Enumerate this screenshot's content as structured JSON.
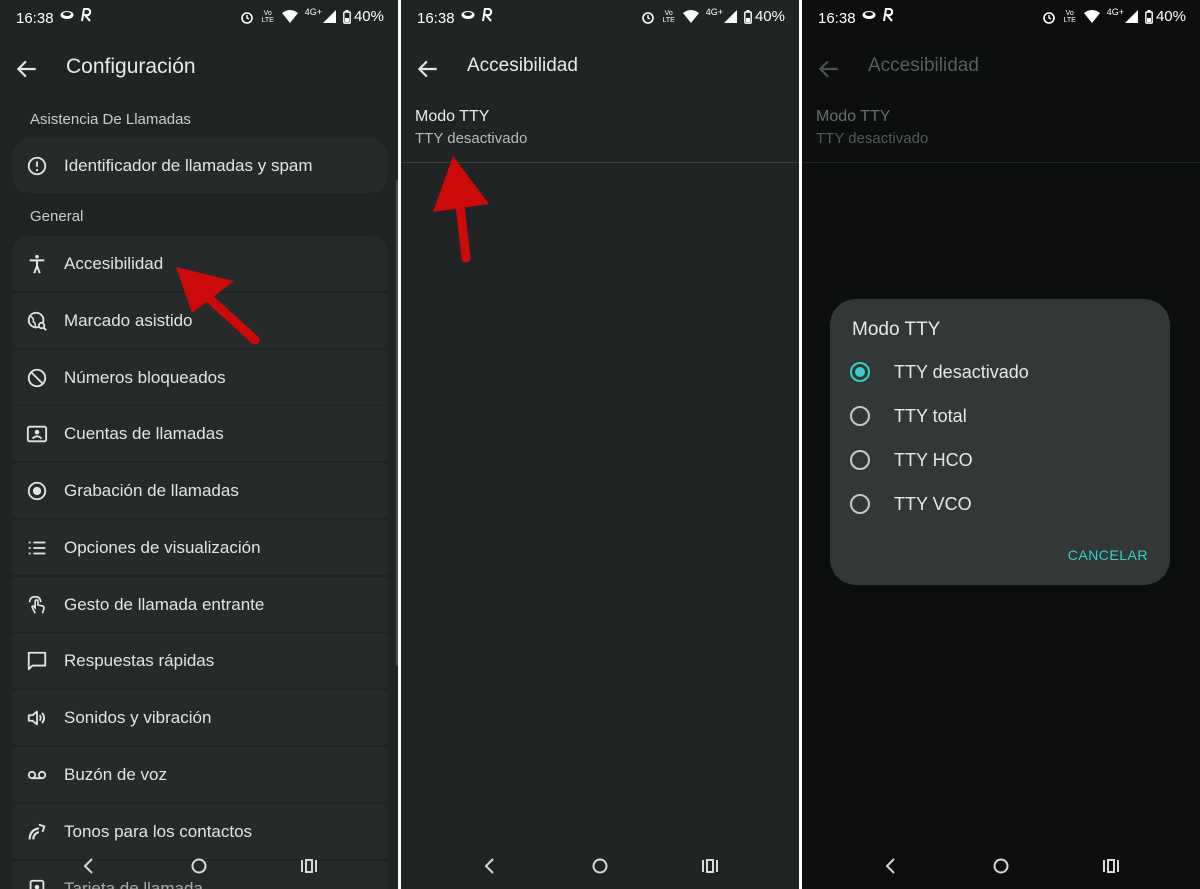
{
  "status": {
    "time": "16:38",
    "network": "4G+",
    "battery": "40%",
    "volte": "Vo\nLTE"
  },
  "settings": {
    "title": "Configuración",
    "section_calls": "Asistencia De Llamadas",
    "spam_item": "Identificador de llamadas y spam",
    "section_general": "General",
    "items": [
      {
        "label": "Accesibilidad",
        "icon": "accessibility-icon"
      },
      {
        "label": "Marcado asistido",
        "icon": "assisted-dialing-icon"
      },
      {
        "label": "Números bloqueados",
        "icon": "block-icon"
      },
      {
        "label": "Cuentas de llamadas",
        "icon": "contact-card-icon"
      },
      {
        "label": "Grabación de llamadas",
        "icon": "record-icon"
      },
      {
        "label": "Opciones de visualización",
        "icon": "list-icon"
      },
      {
        "label": "Gesto de llamada entrante",
        "icon": "swipe-gesture-icon"
      },
      {
        "label": "Respuestas rápidas",
        "icon": "message-icon"
      },
      {
        "label": "Sonidos y vibración",
        "icon": "volume-icon"
      },
      {
        "label": "Buzón de voz",
        "icon": "voicemail-icon"
      },
      {
        "label": "Tonos para los contactos",
        "icon": "ringtone-icon"
      },
      {
        "label": "Tarjeta de llamada",
        "icon": "call-card-icon"
      }
    ]
  },
  "accessibility": {
    "title": "Accesibilidad",
    "tty_title": "Modo TTY",
    "tty_value": "TTY desactivado"
  },
  "dialog": {
    "title": "Modo TTY",
    "options": [
      {
        "label": "TTY desactivado",
        "selected": true
      },
      {
        "label": "TTY total",
        "selected": false
      },
      {
        "label": "TTY HCO",
        "selected": false
      },
      {
        "label": "TTY VCO",
        "selected": false
      }
    ],
    "cancel": "CANCELAR"
  },
  "colors": {
    "accent": "#36d0cc",
    "annotation_arrow": "#cc0a0a",
    "background": "#202424"
  }
}
